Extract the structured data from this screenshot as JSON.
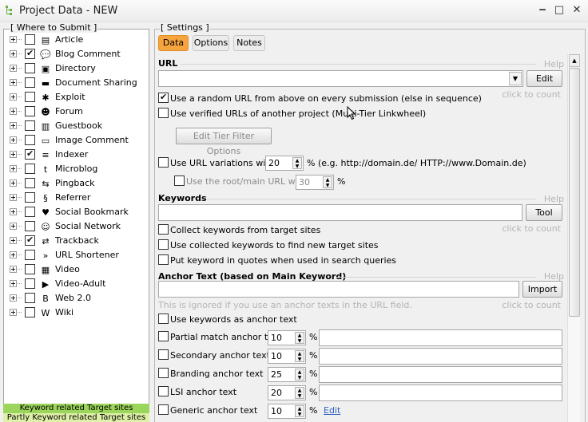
{
  "window": {
    "title": "Project Data - NEW",
    "controls": [
      "‒",
      "□",
      "✕"
    ]
  },
  "left_panel": {
    "legend": "[ Where to Submit ]",
    "items": [
      {
        "label": "Article",
        "checked": false,
        "icon": "article-icon",
        "glyph": "▤"
      },
      {
        "label": "Blog Comment",
        "checked": true,
        "icon": "comment-icon",
        "glyph": "💬"
      },
      {
        "label": "Directory",
        "checked": false,
        "icon": "folder-icon",
        "glyph": "▣"
      },
      {
        "label": "Document Sharing",
        "checked": false,
        "icon": "document-folder-icon",
        "glyph": "▬"
      },
      {
        "label": "Exploit",
        "checked": false,
        "icon": "bug-icon",
        "glyph": "✱"
      },
      {
        "label": "Forum",
        "checked": false,
        "icon": "forum-users-icon",
        "glyph": "☻"
      },
      {
        "label": "Guestbook",
        "checked": false,
        "icon": "book-icon",
        "glyph": "▥"
      },
      {
        "label": "Image Comment",
        "checked": false,
        "icon": "image-icon",
        "glyph": "▭"
      },
      {
        "label": "Indexer",
        "checked": true,
        "icon": "indexer-icon",
        "glyph": "≡"
      },
      {
        "label": "Microblog",
        "checked": false,
        "icon": "twitter-icon",
        "glyph": "t"
      },
      {
        "label": "Pingback",
        "checked": false,
        "icon": "pingback-icon",
        "glyph": "⇆"
      },
      {
        "label": "Referrer",
        "checked": false,
        "icon": "referrer-icon",
        "glyph": "§"
      },
      {
        "label": "Social Bookmark",
        "checked": false,
        "icon": "heart-icon",
        "glyph": "♥"
      },
      {
        "label": "Social Network",
        "checked": false,
        "icon": "network-users-icon",
        "glyph": "☺"
      },
      {
        "label": "Trackback",
        "checked": true,
        "icon": "trackback-icon",
        "glyph": "⇄"
      },
      {
        "label": "URL Shortener",
        "checked": false,
        "icon": "chevrons-icon",
        "glyph": "»"
      },
      {
        "label": "Video",
        "checked": false,
        "icon": "film-icon",
        "glyph": "▦"
      },
      {
        "label": "Video-Adult",
        "checked": false,
        "icon": "play-icon",
        "glyph": "▶"
      },
      {
        "label": "Web 2.0",
        "checked": false,
        "icon": "blogger-icon",
        "glyph": "B"
      },
      {
        "label": "Wiki",
        "checked": false,
        "icon": "wiki-icon",
        "glyph": "W"
      }
    ],
    "legend_bottom": {
      "keyword_related": "Keyword related Target sites",
      "partly_related": "Partly Keyword related Target sites"
    }
  },
  "settings": {
    "legend": "[ Settings ]",
    "tabs": [
      {
        "label": "Data",
        "active": true
      },
      {
        "label": "Options",
        "active": false
      },
      {
        "label": "Notes",
        "active": false
      }
    ],
    "url": {
      "heading": "URL",
      "help": "Help",
      "edit_button": "Edit",
      "click_to_count": "click to count",
      "random_url": {
        "label": "Use a random URL from above on every submission (else in sequence)",
        "checked": true
      },
      "verified_urls": {
        "label": "Use verified URLs of another project (Multi-Tier Linkwheel)",
        "checked": false
      },
      "tier_filter_button": "Edit Tier Filter Options",
      "variations": {
        "label": "Use URL variations with",
        "value": "20",
        "suffix": "% (e.g. http://domain.de/ HTTP://www.Domain.de)",
        "checked": false
      },
      "root_url": {
        "label": "Use the root/main URL with",
        "value": "30",
        "suffix": "%",
        "checked": false
      }
    },
    "keywords": {
      "heading": "Keywords",
      "help": "Help",
      "tool_button": "Tool",
      "click_to_count": "click to count",
      "options": [
        {
          "label": "Collect keywords from target sites",
          "checked": false
        },
        {
          "label": "Use collected keywords to find new target sites",
          "checked": false
        },
        {
          "label": "Put keyword in quotes when used in search queries",
          "checked": false
        }
      ]
    },
    "anchor": {
      "heading": "Anchor Text (based on Main Keyword)",
      "help": "Help",
      "import_button": "Import",
      "note": "This is ignored if you use an anchor texts in the URL field.",
      "click_to_count": "click to count",
      "use_keywords": {
        "label": "Use keywords as anchor text",
        "checked": false
      },
      "rows": [
        {
          "label": "Partial match anchor text",
          "value": "10",
          "checked": false,
          "edit": ""
        },
        {
          "label": "Secondary anchor text",
          "value": "10",
          "checked": false,
          "edit": ""
        },
        {
          "label": "Branding anchor text",
          "value": "25",
          "checked": false,
          "edit": ""
        },
        {
          "label": "LSI anchor text",
          "value": "20",
          "checked": false,
          "edit": ""
        },
        {
          "label": "Generic anchor text",
          "value": "10",
          "checked": false,
          "edit": "Edit"
        }
      ],
      "percent_sign": "%"
    }
  },
  "colors": {
    "active_tab": "#f6a53e",
    "keyword_related_bg": "#9bd55b",
    "partly_related_bg": "#dff0a8",
    "hint_gray": "#b4b4b4",
    "link_blue": "#2b62c6"
  }
}
